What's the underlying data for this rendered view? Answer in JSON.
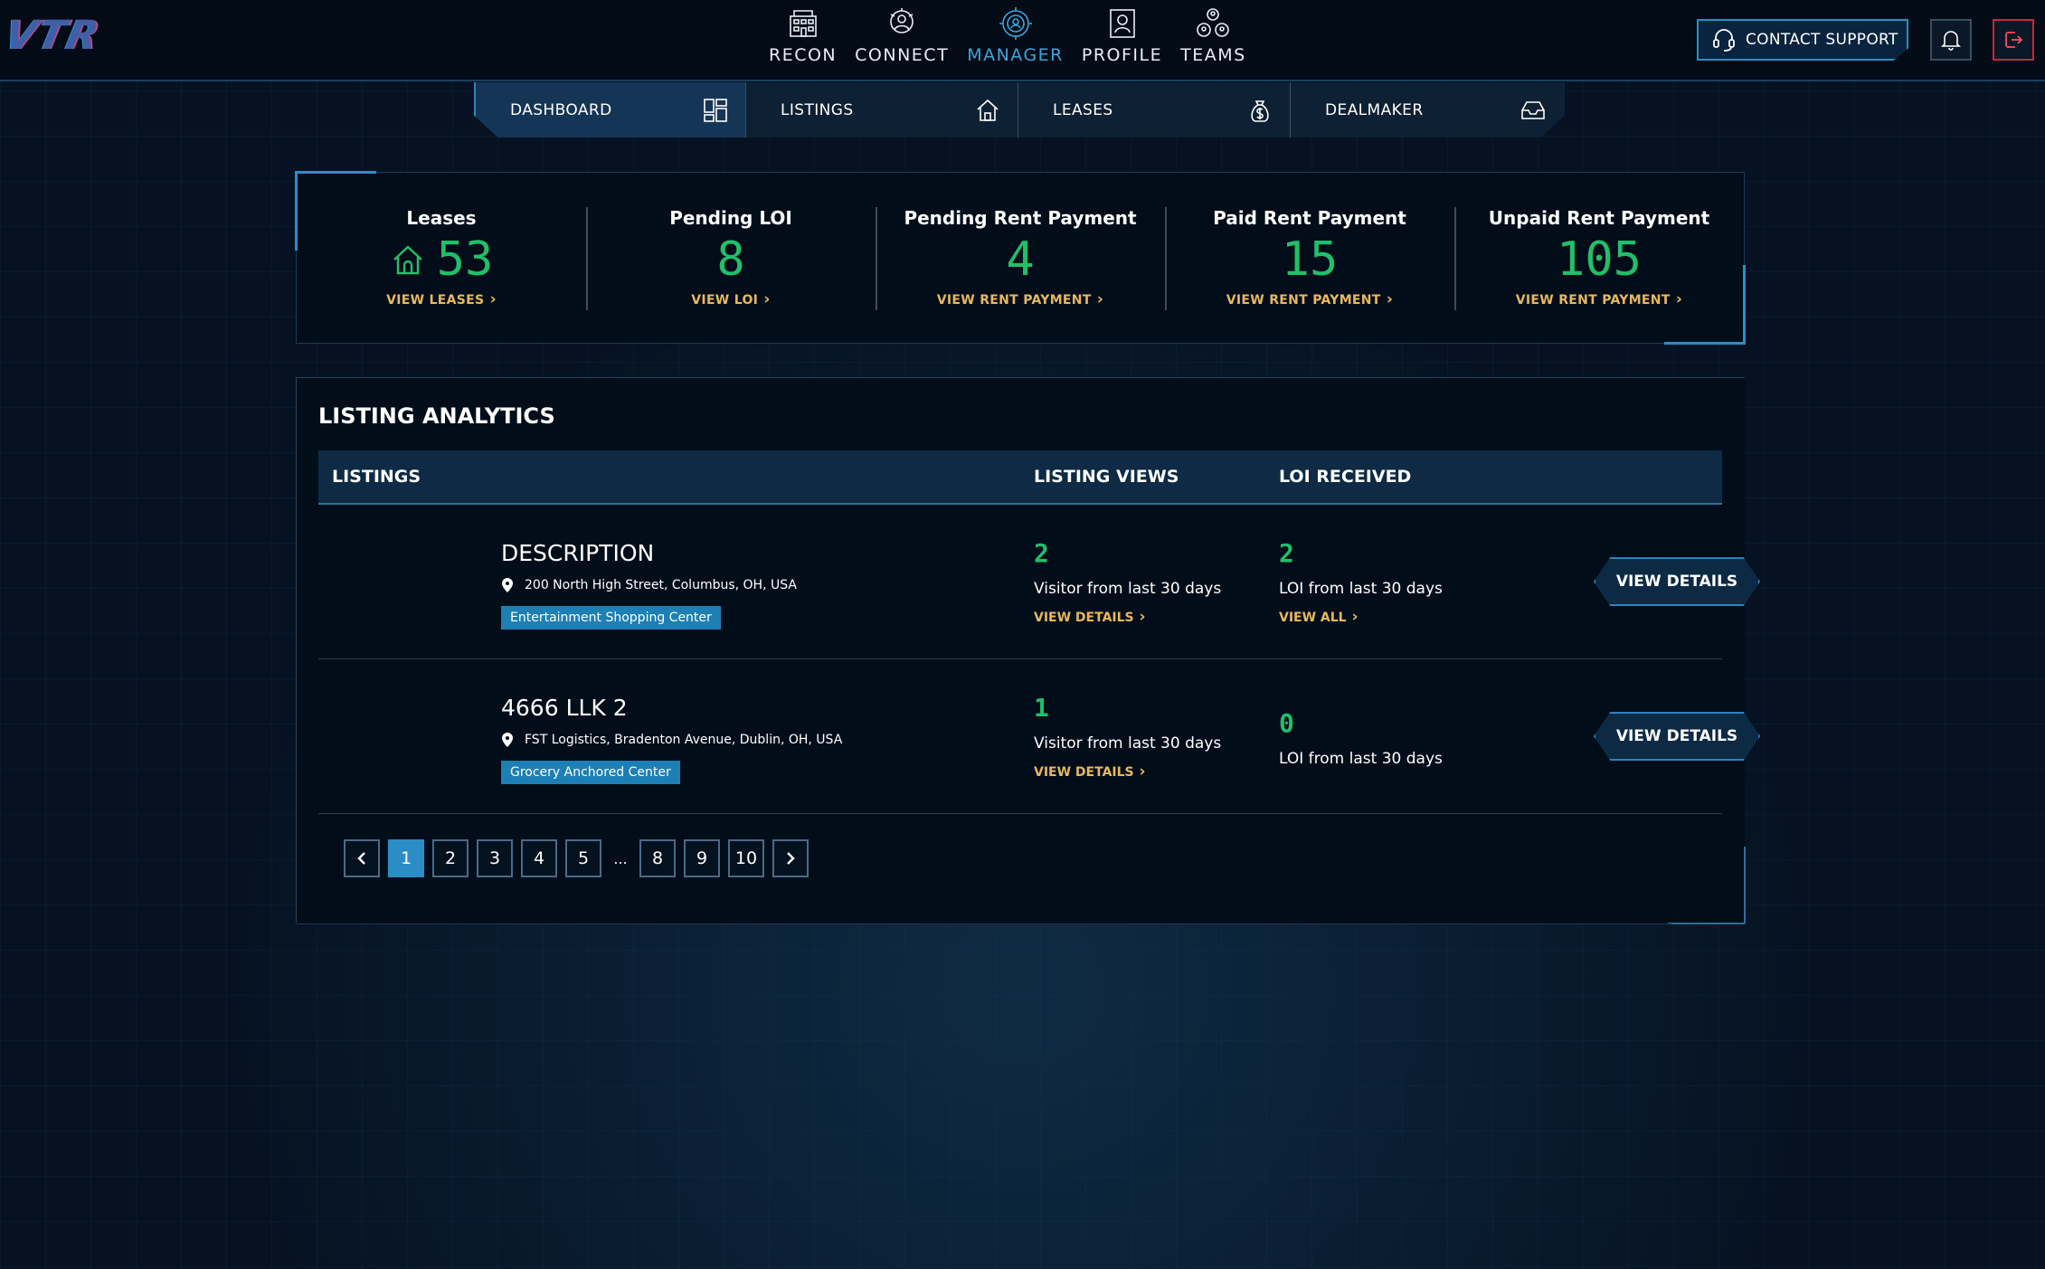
{
  "brand": {
    "logo_text": "VTR"
  },
  "main_nav": [
    {
      "label": "RECON",
      "icon": "building-icon",
      "active": false
    },
    {
      "label": "CONNECT",
      "icon": "connect-icon",
      "active": false
    },
    {
      "label": "MANAGER",
      "icon": "manager-icon",
      "active": true
    },
    {
      "label": "PROFILE",
      "icon": "profile-icon",
      "active": false
    },
    {
      "label": "TEAMS",
      "icon": "teams-icon",
      "active": false
    }
  ],
  "header": {
    "contact_support": "CONTACT SUPPORT",
    "notifications_icon": "bell-icon",
    "logout_icon": "logout-icon"
  },
  "sub_nav": [
    {
      "label": "DASHBOARD",
      "icon": "dashboard-icon",
      "active": true
    },
    {
      "label": "LISTINGS",
      "icon": "home-icon",
      "active": false
    },
    {
      "label": "LEASES",
      "icon": "money-bag-icon",
      "active": false
    },
    {
      "label": "DEALMAKER",
      "icon": "inbox-icon",
      "active": false
    }
  ],
  "stats": [
    {
      "label": "Leases",
      "value": "53",
      "link": "VIEW LEASES"
    },
    {
      "label": "Pending LOI",
      "value": "8",
      "link": "VIEW LOI"
    },
    {
      "label": "Pending Rent Payment",
      "value": "4",
      "link": "VIEW RENT PAYMENT"
    },
    {
      "label": "Paid Rent Payment",
      "value": "15",
      "link": "VIEW RENT PAYMENT"
    },
    {
      "label": "Unpaid Rent Payment",
      "value": "105",
      "link": "VIEW RENT PAYMENT"
    }
  ],
  "analytics": {
    "title": "LISTING ANALYTICS",
    "columns": [
      "LISTINGS",
      "LISTING VIEWS",
      "LOI RECEIVED"
    ],
    "rows": [
      {
        "title": "DESCRIPTION",
        "address": "200 North High Street, Columbus, OH, USA",
        "tag": "Entertainment Shopping Center",
        "views": "2",
        "views_text": "Visitor from last 30 days",
        "views_link": "VIEW DETAILS",
        "loi": "2",
        "loi_text": "LOI from last 30 days",
        "loi_link": "VIEW ALL",
        "button": "VIEW DETAILS"
      },
      {
        "title": "4666 LLK 2",
        "address": "FST Logistics, Bradenton Avenue, Dublin, OH, USA",
        "tag": "Grocery Anchored Center",
        "views": "1",
        "views_text": "Visitor from last 30 days",
        "views_link": "VIEW DETAILS",
        "loi": "0",
        "loi_text": "LOI from last 30 days",
        "loi_link": "",
        "button": "VIEW DETAILS"
      }
    ]
  },
  "pagination": {
    "prev_icon": "chevron-left-icon",
    "next_icon": "chevron-right-icon",
    "pages": [
      "1",
      "2",
      "3",
      "4",
      "5",
      "8",
      "9",
      "10"
    ],
    "ellipsis": "...",
    "current": "1"
  },
  "colors": {
    "accent": "#2b8dc6",
    "value_green": "#20c06a",
    "link_gold": "#e8b85a",
    "manager_active": "#3aa6dc",
    "logout_red": "#c8263a"
  }
}
